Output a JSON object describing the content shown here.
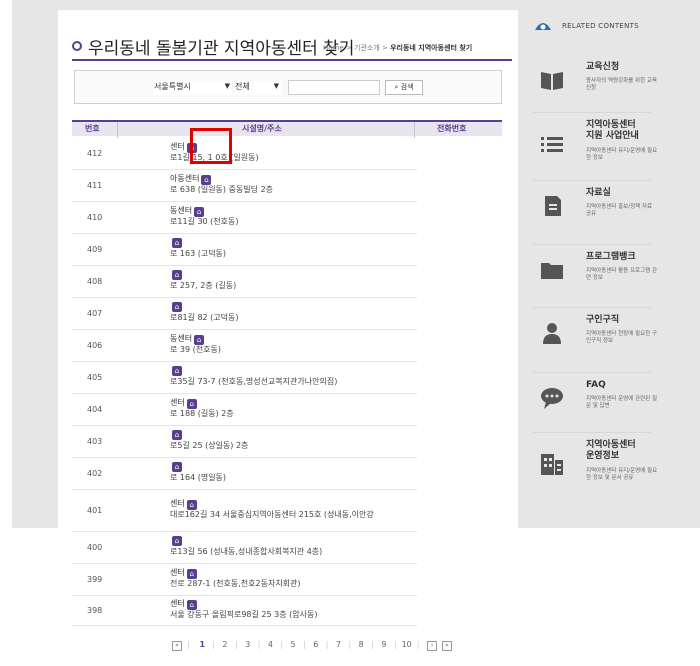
{
  "title": "우리동네 돌봄기관 지역아동센터 찾기",
  "breadcrumb": {
    "home": "Home",
    "sep1": " > ",
    "about": "기관소개",
    "sep2": " > ",
    "current": "우리동네 지역아동센터 찾기"
  },
  "search": {
    "city": "서울특별시",
    "district": "전체",
    "button": "검색",
    "button_icon": "search-icon"
  },
  "table": {
    "headers": {
      "num": "번호",
      "name": "시설명/주소",
      "phone": "전화번호"
    },
    "rows": [
      {
        "num": "412",
        "name": "센터",
        "addr": "로1길 15, 1 0호 (일원동)"
      },
      {
        "num": "411",
        "name": "아동센터",
        "addr": "로 638 (일원동) 중동빌딩 2층"
      },
      {
        "num": "410",
        "name": "동센터",
        "addr": "로11길 30 (천호동)"
      },
      {
        "num": "409",
        "name": "",
        "addr": "로 163 (고덕동)"
      },
      {
        "num": "408",
        "name": "",
        "addr": "로 257, 2층 (길동)"
      },
      {
        "num": "407",
        "name": "",
        "addr": "로81길 82 (고덕동)"
      },
      {
        "num": "406",
        "name": "동센터",
        "addr": "로 39 (천호동)"
      },
      {
        "num": "405",
        "name": "",
        "addr": "로35길 73-7 (천호동,명성선교복지관가나안의집)"
      },
      {
        "num": "404",
        "name": "센터",
        "addr": "로 188 (길동) 2층"
      },
      {
        "num": "403",
        "name": "",
        "addr": "로5길 25 (상일동) 2층"
      },
      {
        "num": "402",
        "name": "",
        "addr": "로 164 (명일동)"
      },
      {
        "num": "401",
        "name": "센터",
        "addr": "대로162길 34 서울중심지역아동센터 215호 (성내동,이안강"
      },
      {
        "num": "400",
        "name": "",
        "addr": "로13길 56 (성내동,성내종합사회복지관 4층)"
      },
      {
        "num": "399",
        "name": "센터",
        "addr": "전로 287-1 (천호동,천호2동자치회관)"
      },
      {
        "num": "398",
        "name": "센터",
        "addr": "서울 강동구 올림픽로98길 25 3층 (암사동)"
      }
    ]
  },
  "pagination": {
    "first": "«",
    "prev": "‹",
    "pages": [
      "1",
      "2",
      "3",
      "4",
      "5",
      "6",
      "7",
      "8",
      "9",
      "10"
    ],
    "current": "1",
    "next": "›",
    "last": "»"
  },
  "related": {
    "title": "RELATED CONTENTS",
    "items": [
      {
        "title": "교육신청",
        "desc": "종사자의 역량강화를 위한 교육 신청",
        "icon": "book-icon"
      },
      {
        "title": "지역아동센터 지원 사업안내",
        "desc": "지역아동센터 유지/운영에 필요한 정보",
        "icon": "list-icon"
      },
      {
        "title": "자료실",
        "desc": "지역아동센터 홍보/정책 자료 공유",
        "icon": "document-icon"
      },
      {
        "title": "프로그램뱅크",
        "desc": "지역아동센터 활용 프로그램 관련 정보",
        "icon": "folder-icon"
      },
      {
        "title": "구인구직",
        "desc": "지역아동센터 현장에 필요한 구인구직 정보",
        "icon": "person-icon"
      },
      {
        "title": "FAQ",
        "desc": "지역아동센터 운영에 관련된 질문 및 답변",
        "icon": "chat-icon"
      },
      {
        "title": "지역아동센터 운영정보",
        "desc": "지역아동센터 유지/운영에 필요한 정보 및 문서 공유",
        "icon": "building-icon"
      }
    ]
  },
  "colors": {
    "accent": "#5b3f8f",
    "highlight": "#e00000",
    "band": "#e6e6e6"
  }
}
